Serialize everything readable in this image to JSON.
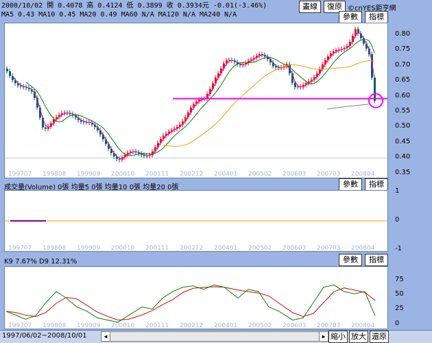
{
  "header": {
    "quote_line": "2000/10/02 開 0.4078 高 0.4124 低 0.3899 收 0.3934元 -0.01(-3.46%)",
    "ma_line": "MA5 0.43   MA10 0.45   MA20 0.49   MA60 N/A   MA120 N/A   MA240 N/A",
    "btn_line": "畫線",
    "btn_restore": "復原",
    "copyright": "©cnYES鉅亨網"
  },
  "price_panel": {
    "params_label": "參數",
    "indicator_label": "指標",
    "y_ticks": [
      "0.80",
      "0.75",
      "0.70",
      "0.65",
      "0.60",
      "0.55",
      "0.50",
      "0.45",
      "0.40",
      "0.35"
    ],
    "x_ticks": [
      "199707",
      "199808",
      "199909",
      "200010",
      "200111",
      "200212",
      "200401",
      "200502",
      "200603",
      "200703",
      "200804"
    ]
  },
  "volume_panel": {
    "title": "成交量(Volume) 0張   均量5 0張   均量10 0張   均量20 0張",
    "params_label": "參數",
    "indicator_label": "指標",
    "y_ticks": [
      "1",
      "0",
      "-1"
    ],
    "x_ticks": [
      "199707",
      "199808",
      "199909",
      "200010",
      "200111",
      "200212",
      "200401",
      "200502",
      "200603",
      "200703",
      "200804"
    ]
  },
  "kd_panel": {
    "title": "K9 7.67%   D9 12.31%",
    "params_label": "參數",
    "indicator_label": "指標",
    "y_ticks": [
      "75",
      "50",
      "25",
      "0"
    ],
    "x_ticks": [
      "199707",
      "199808",
      "199909",
      "200010",
      "200111",
      "200212",
      "200401",
      "200502",
      "200603",
      "200703",
      "200804"
    ]
  },
  "footer": {
    "date_range": "1997/06/02~2008/10/01",
    "zoom_out": "縮小",
    "zoom_in": "放大",
    "restore": "還原"
  },
  "colors": {
    "ma_short": "#e000e0",
    "ma_mid": "#008000",
    "ma_long": "#ff9900",
    "support": "#ff00ff",
    "k": "#008000",
    "d": "#e00000",
    "up": "#ff0000",
    "down": "#006060"
  }
}
